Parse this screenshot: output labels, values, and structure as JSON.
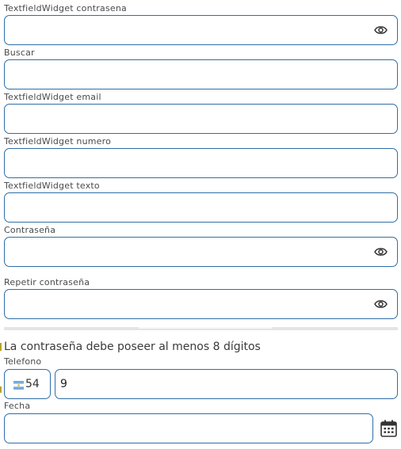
{
  "form": {
    "fields": [
      {
        "label": "TextfieldWidget contrasena",
        "value": "",
        "has_eye": true
      },
      {
        "label": "Buscar",
        "value": "",
        "has_eye": false
      },
      {
        "label": "TextfieldWidget email",
        "value": "",
        "has_eye": false
      },
      {
        "label": "TextfieldWidget numero",
        "value": "",
        "has_eye": false
      },
      {
        "label": "TextfieldWidget texto",
        "value": "",
        "has_eye": false
      },
      {
        "label": "Contraseña",
        "value": "",
        "has_eye": true
      },
      {
        "label": "Repetir contraseña",
        "value": "",
        "has_eye": true
      }
    ],
    "password_hint": "La contraseña debe poseer al menos 8 dígitos",
    "phone": {
      "label": "Telefono",
      "country_code": "54",
      "number": "9",
      "flag_icon": "argentina-flag-icon"
    },
    "date": {
      "label": "Fecha",
      "value": "",
      "icon": "calendar-icon"
    }
  },
  "colors": {
    "border": "#2f6ea6",
    "label": "#4a4a4a",
    "icon": "#333333",
    "flag_blue": "#74acdf",
    "flag_sun": "#f6b40e"
  }
}
